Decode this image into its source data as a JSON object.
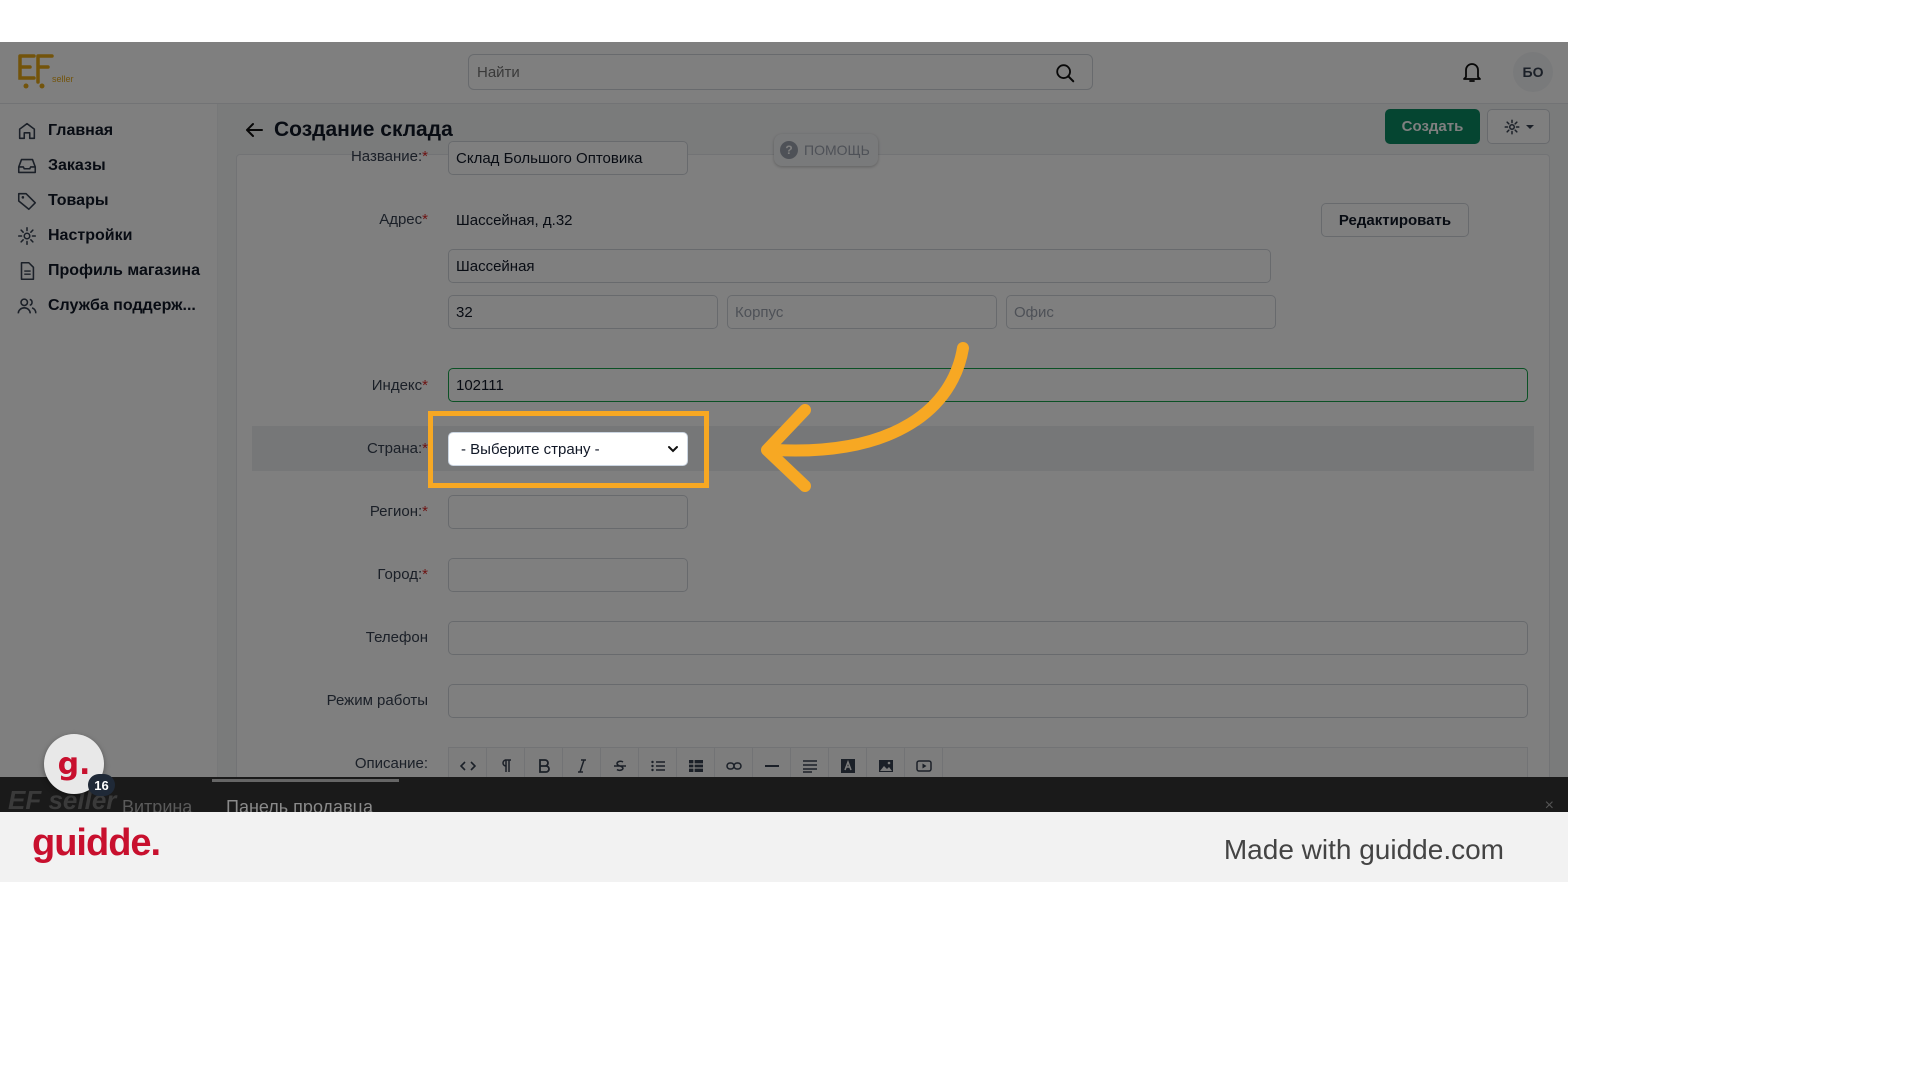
{
  "header": {
    "logo_text": "seller",
    "search_placeholder": "Найти",
    "avatar_initials": "БО"
  },
  "sidebar": {
    "items": [
      {
        "label": "Главная",
        "icon": "home-icon"
      },
      {
        "label": "Заказы",
        "icon": "inbox-icon"
      },
      {
        "label": "Товары",
        "icon": "tag-icon"
      },
      {
        "label": "Настройки",
        "icon": "gear-icon"
      },
      {
        "label": "Профиль магазина",
        "icon": "document-icon"
      },
      {
        "label": "Служба поддерж...",
        "icon": "users-icon"
      }
    ]
  },
  "page": {
    "title": "Создание склада",
    "create_label": "Создать",
    "help_label": "ПОМОЩЬ"
  },
  "form": {
    "name_label": "Название:",
    "name_value": "Склад Большого Оптовика",
    "address_label": "Адрес",
    "address_display": "Шассейная, д.32",
    "edit_label": "Редактировать",
    "street_value": "Шассейная",
    "house_value": "32",
    "building_placeholder": "Корпус",
    "office_placeholder": "Офис",
    "index_label": "Индекс",
    "index_value": "102111",
    "country_label": "Страна:",
    "country_selected": "- Выберите страну -",
    "region_label": "Регион:",
    "city_label": "Город:",
    "phone_label": "Телефон",
    "hours_label": "Режим работы",
    "description_label": "Описание:",
    "required_mark": "*"
  },
  "bottom_bar": {
    "logo": "EF seller",
    "items": [
      "Витрина",
      "Панель продавца"
    ],
    "close": "×"
  },
  "guidde": {
    "badge_letter": "g.",
    "badge_count": "16",
    "brand": "guidde.",
    "made_with": "Made with guidde.com"
  },
  "colors": {
    "accent_green": "#0b8a63",
    "highlight_orange": "#f7a823",
    "required_red": "#dc2626",
    "guidde_red": "#c8102e"
  }
}
